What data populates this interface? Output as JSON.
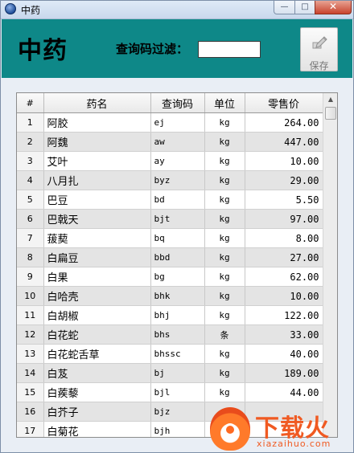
{
  "window": {
    "title": "中药",
    "buttons": {
      "minimize": "—",
      "maximize": "□",
      "close": "✕"
    }
  },
  "header": {
    "title": "中药",
    "filter_label": "查询码过滤：",
    "filter_value": "",
    "save_label": "保存",
    "background": "#0e8888"
  },
  "table": {
    "columns": [
      "#",
      "药名",
      "查询码",
      "单位",
      "零售价"
    ],
    "rows": [
      [
        "1",
        "阿胶",
        "ej",
        "kg",
        "264.00"
      ],
      [
        "2",
        "阿魏",
        "aw",
        "kg",
        "447.00"
      ],
      [
        "3",
        "艾叶",
        "ay",
        "kg",
        "10.00"
      ],
      [
        "4",
        "八月扎",
        "byz",
        "kg",
        "29.00"
      ],
      [
        "5",
        "巴豆",
        "bd",
        "kg",
        "5.50"
      ],
      [
        "6",
        "巴戟天",
        "bjt",
        "kg",
        "97.00"
      ],
      [
        "7",
        "菝葜",
        "bq",
        "kg",
        "8.00"
      ],
      [
        "8",
        "白扁豆",
        "bbd",
        "kg",
        "27.00"
      ],
      [
        "9",
        "白果",
        "bg",
        "kg",
        "62.00"
      ],
      [
        "10",
        "白哈壳",
        "bhk",
        "kg",
        "10.00"
      ],
      [
        "11",
        "白胡椒",
        "bhj",
        "kg",
        "122.00"
      ],
      [
        "12",
        "白花蛇",
        "bhs",
        "条",
        "33.00"
      ],
      [
        "13",
        "白花蛇舌草",
        "bhssc",
        "kg",
        "40.00"
      ],
      [
        "14",
        "白芨",
        "bj",
        "kg",
        "189.00"
      ],
      [
        "15",
        "白蒺藜",
        "bjl",
        "kg",
        "44.00"
      ],
      [
        "16",
        "白芥子",
        "bjz",
        "",
        ""
      ],
      [
        "17",
        "白菊花",
        "bjh",
        "",
        ""
      ]
    ]
  },
  "watermark": {
    "cn": "下载火",
    "en": "xiazaihuo.com"
  },
  "icons": {
    "app": "app-icon",
    "save": "save-pencil-icon",
    "scroll_up": "scroll-up-arrow-icon"
  }
}
